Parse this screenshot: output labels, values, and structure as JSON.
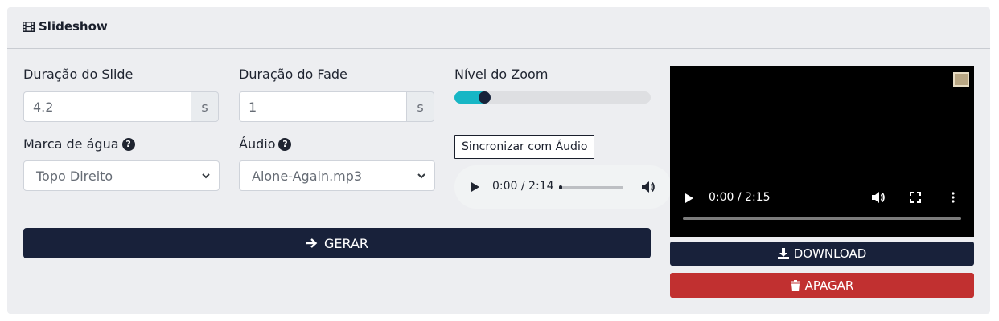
{
  "card": {
    "title": "Slideshow",
    "icon": "film-icon"
  },
  "slide_duration": {
    "label": "Duração do Slide",
    "value": "4.2",
    "unit": "s"
  },
  "fade_duration": {
    "label": "Duração do Fade",
    "value": "1",
    "unit": "s"
  },
  "zoom": {
    "label": "Nível do Zoom",
    "level_fraction": 0.12,
    "accent": "#17b6c5"
  },
  "watermark": {
    "label": "Marca de água",
    "selected": "Topo Direito"
  },
  "audio_select": {
    "label": "Áudio",
    "selected": "Alone-Again.mp3"
  },
  "sync_button": {
    "label": "Sincronizar com Áudio"
  },
  "audio_player": {
    "time": "0:00 / 2:14"
  },
  "video_player": {
    "time": "0:00 / 2:15"
  },
  "generate_button": {
    "label": "GERAR"
  },
  "download_button": {
    "label": "DOWNLOAD"
  },
  "delete_button": {
    "label": "APAGAR"
  },
  "colors": {
    "primary": "#18213a",
    "danger": "#c13030",
    "accent": "#17b6c5"
  }
}
